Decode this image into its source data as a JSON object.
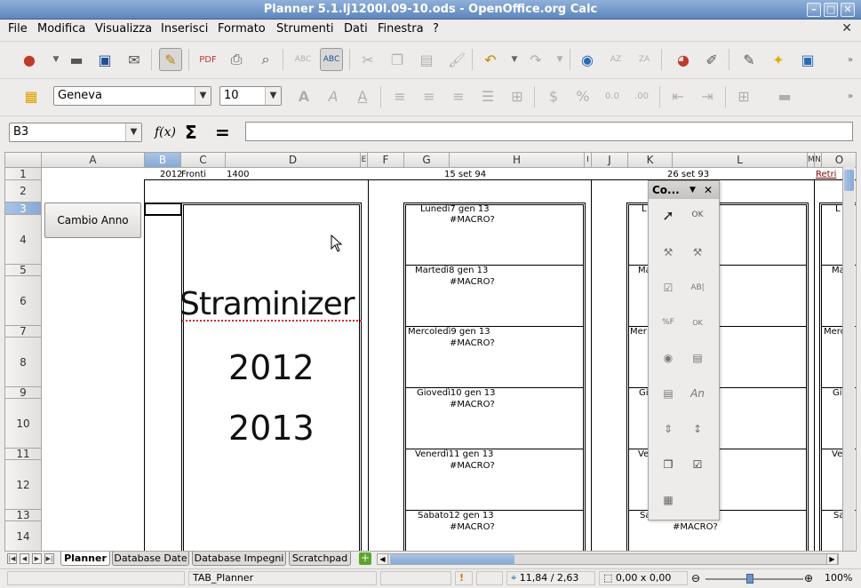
{
  "window": {
    "title": "Planner 5.1.lj1200l.09-10.ods - OpenOffice.org Calc"
  },
  "menu": [
    "File",
    "Modifica",
    "Visualizza",
    "Inserisci",
    "Formato",
    "Strumenti",
    "Dati",
    "Finestra",
    "?"
  ],
  "format_bar": {
    "font_name": "Geneva",
    "font_size": "10"
  },
  "formula_bar": {
    "name_box": "B3",
    "fx": "f(x)",
    "sum": "Σ",
    "equals": "=",
    "formula": ""
  },
  "columns": [
    "A",
    "B",
    "C",
    "D",
    "E",
    "F",
    "G",
    "H",
    "I",
    "J",
    "K",
    "L",
    "M",
    "N",
    "O"
  ],
  "rows": [
    "1",
    "2",
    "3",
    "4",
    "5",
    "6",
    "7",
    "8",
    "9",
    "10",
    "11",
    "12",
    "13",
    "14"
  ],
  "row1": {
    "b": "2012",
    "c": "Fronti",
    "c2": "1400",
    "h": "15 set 94",
    "k": "26 set 93",
    "o": "Retri"
  },
  "button": {
    "label": "Cambio Anno"
  },
  "big_text": {
    "name": "Straminizer",
    "year1": "2012",
    "year2": "2013"
  },
  "days": [
    {
      "label": "Lunedì7 gen 13",
      "macro": "#MACRO?"
    },
    {
      "label": "Martedì8 gen 13",
      "macro": "#MACRO?"
    },
    {
      "label": "Mercoledì9 gen 13",
      "macro": "#MACRO?"
    },
    {
      "label": "Giovedì10 gen 13",
      "macro": "#MACRO?"
    },
    {
      "label": "Venerdì11 gen 13",
      "macro": "#MACRO?"
    },
    {
      "label": "Sabato12 gen 13",
      "macro": "#MACRO?"
    }
  ],
  "mid_days": [
    "L",
    "Ma",
    "Mer",
    "Gi",
    "Ve",
    "Sa"
  ],
  "mid_macro_last": "#MACRO?",
  "right_days": [
    "L",
    "Ma",
    "Merc",
    "Gi",
    "Ve",
    "Sa"
  ],
  "controls_panel": {
    "title": "Co..."
  },
  "sheet_tabs": [
    "Planner",
    "Database Date",
    "Database Impegni",
    "Scratchpad"
  ],
  "status": {
    "sheet_style": "TAB_Planner",
    "position": "11,84 / 2,63",
    "size": "0,00 x 0,00",
    "zoom": "100%"
  }
}
